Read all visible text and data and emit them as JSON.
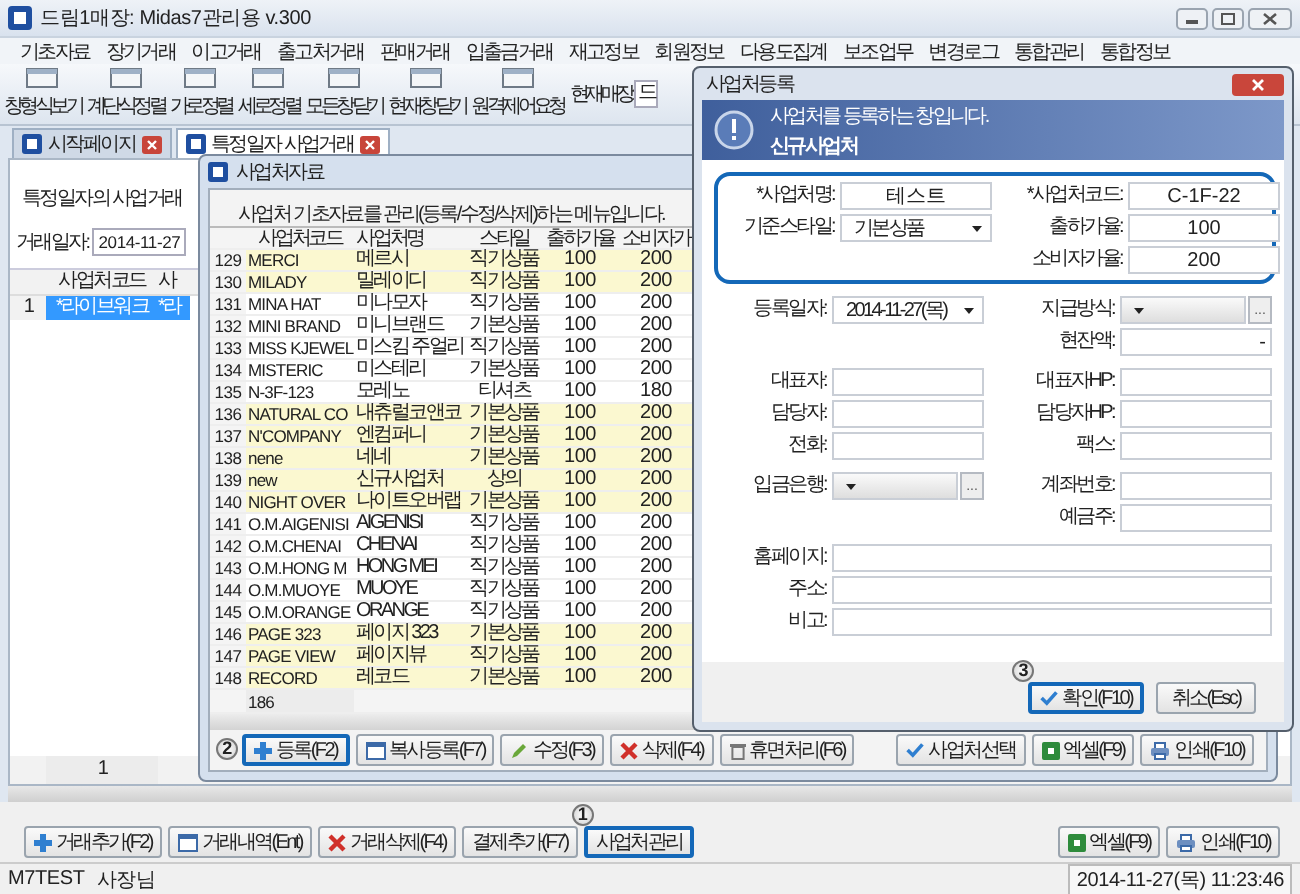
{
  "window": {
    "title": "드림1매장: Midas7관리용 v.300"
  },
  "menu": [
    "기초자료",
    "장기거래",
    "이고거래",
    "출고처거래",
    "판매거래",
    "입출금거래",
    "재고정보",
    "회원정보",
    "다용도집계",
    "보조업무",
    "변경로그",
    "통합관리",
    "통합정보"
  ],
  "toolbar": {
    "buttons": [
      "창형식보기",
      "계단식정렬",
      "가로정렬",
      "세로정렬",
      "모든창닫기",
      "현재창닫기",
      "원격제어요청"
    ],
    "store_label": "현재매장:",
    "store_value": "드"
  },
  "tabs": [
    {
      "label": "시작페이지",
      "selected": false
    },
    {
      "label": "특정일자 사업거래",
      "selected": true
    }
  ],
  "page": {
    "description": "특정일자의 사업거래",
    "date_label": "거래일자:",
    "date_value": "2014-11-27",
    "grid": {
      "columns": [
        "사업처코드",
        "사"
      ],
      "rows": [
        {
          "number": "1",
          "cells": [
            "*라이브워크",
            "*라"
          ],
          "selected": true
        }
      ],
      "footer": "1"
    }
  },
  "bottom_buttons": [
    {
      "label": "거래추가(F2)",
      "highlighted": false
    },
    {
      "label": "거래내역(Ent)",
      "highlighted": false
    },
    {
      "label": "거래삭제(F4)",
      "highlighted": false
    },
    {
      "label": "결제추가(F7)",
      "highlighted": false
    },
    {
      "label": "사업처관리",
      "highlighted": true,
      "callout": "1"
    }
  ],
  "bottom_right_buttons": [
    "엑셀(F9)",
    "인쇄(F10)"
  ],
  "status_bar": {
    "user": "M7TEST",
    "role": "사장님",
    "datetime": "2014-11-27(목) 11:23:46"
  },
  "child_window": {
    "title": "사업처자료",
    "description": "사업처 기초자료를 관리(등록/수정/삭제)하는 메뉴입니다.",
    "table": {
      "columns": [
        "사업처코드",
        "사업처명",
        "스타일",
        "출하가율",
        "소비자가"
      ],
      "rows": [
        {
          "number": "129",
          "cells": [
            "MERCI",
            "메르시",
            "직기상품",
            "100",
            "200"
          ],
          "highlighted": true
        },
        {
          "number": "130",
          "cells": [
            "MILADY",
            "밀레이디",
            "직기상품",
            "100",
            "200"
          ],
          "highlighted": true
        },
        {
          "number": "131",
          "cells": [
            "MINA HAT",
            "미나모자",
            "직기상품",
            "100",
            "200"
          ],
          "highlighted": false
        },
        {
          "number": "132",
          "cells": [
            "MINI BRAND",
            "미니브랜드",
            "기본상품",
            "100",
            "200"
          ],
          "highlighted": false
        },
        {
          "number": "133",
          "cells": [
            "MISS KJEWEL",
            "미스킴 주얼리",
            "직기상품",
            "100",
            "200"
          ],
          "highlighted": false
        },
        {
          "number": "134",
          "cells": [
            "MISTERIC",
            "미스테리",
            "기본상품",
            "100",
            "200"
          ],
          "highlighted": false
        },
        {
          "number": "135",
          "cells": [
            "N-3F-123",
            "모레노",
            "티셔츠",
            "100",
            "180"
          ],
          "highlighted": false
        },
        {
          "number": "136",
          "cells": [
            "NATURAL CO",
            "내츄럴코앤코",
            "기본상품",
            "100",
            "200"
          ],
          "highlighted": true
        },
        {
          "number": "137",
          "cells": [
            "N'COMPANY",
            "엔컴퍼니",
            "기본상품",
            "100",
            "200"
          ],
          "highlighted": true
        },
        {
          "number": "138",
          "cells": [
            "nene",
            "네네",
            "기본상품",
            "100",
            "200"
          ],
          "highlighted": true
        },
        {
          "number": "139",
          "cells": [
            "new",
            "신규사업처",
            "상의",
            "100",
            "200"
          ],
          "highlighted": true
        },
        {
          "number": "140",
          "cells": [
            "NIGHT OVER",
            "나이트오버랩",
            "기본상품",
            "100",
            "200"
          ],
          "highlighted": true
        },
        {
          "number": "141",
          "cells": [
            "O.M.AIGENISI",
            "AIGENISI",
            "직기상품",
            "100",
            "200"
          ],
          "highlighted": false
        },
        {
          "number": "142",
          "cells": [
            "O.M.CHENAI",
            "CHENAI",
            "직기상품",
            "100",
            "200"
          ],
          "highlighted": false
        },
        {
          "number": "143",
          "cells": [
            "O.M.HONG M",
            "HONG MEI",
            "직기상품",
            "100",
            "200"
          ],
          "highlighted": false
        },
        {
          "number": "144",
          "cells": [
            "O.M.MUOYE",
            "MUOYE",
            "직기상품",
            "100",
            "200"
          ],
          "highlighted": false
        },
        {
          "number": "145",
          "cells": [
            "O.M.ORANGE",
            "ORANGE",
            "직기상품",
            "100",
            "200"
          ],
          "highlighted": false
        },
        {
          "number": "146",
          "cells": [
            "PAGE 323",
            "페이지 323",
            "기본상품",
            "100",
            "200"
          ],
          "highlighted": true
        },
        {
          "number": "147",
          "cells": [
            "PAGE VIEW",
            "페이지뷰",
            "직기상품",
            "100",
            "200"
          ],
          "highlighted": true
        },
        {
          "number": "148",
          "cells": [
            "RECORD",
            "레코드",
            "기본상품",
            "100",
            "200"
          ],
          "highlighted": true
        }
      ],
      "footer": "186"
    },
    "buttons": [
      {
        "label": "등록(F2)",
        "highlighted": true,
        "callout": "2"
      },
      {
        "label": "복사등록(F7)",
        "highlighted": false
      },
      {
        "label": "수정(F3)",
        "highlighted": false
      },
      {
        "label": "삭제(F4)",
        "highlighted": false
      },
      {
        "label": "휴면처리(F6)",
        "highlighted": false
      }
    ],
    "right_buttons": [
      "사업처선택",
      "엑셀(F9)",
      "인쇄(F10)"
    ]
  },
  "dialog": {
    "title": "사업처등록",
    "banner_text": "사업처를 등록하는 창입니다.",
    "banner_title": "신규사업처",
    "sections": [
      {
        "highlighted": true,
        "rows": [
          {
            "left": {
              "label": "*사업처명:",
              "kind": "text",
              "value": "테스트"
            },
            "right": {
              "label": "*사업처코드:",
              "kind": "text",
              "value": "C-1F-22"
            }
          },
          {
            "left": {
              "label": "기준스타일:",
              "kind": "select",
              "value": "기본상품"
            },
            "right": {
              "label": "출하가율:",
              "kind": "text",
              "value": "100"
            }
          },
          {
            "right": {
              "label": "소비자가율:",
              "kind": "text",
              "value": "200"
            }
          }
        ]
      },
      {
        "highlighted": false,
        "rows": [
          {
            "left": {
              "label": "등록일자:",
              "kind": "select",
              "value": "2014-11-27(목)"
            },
            "right": {
              "label": "지급방식:",
              "kind": "select_more",
              "more": "..."
            }
          },
          {
            "right": {
              "label": "현잔액:",
              "kind": "amount",
              "value": "-"
            }
          }
        ]
      },
      {
        "highlighted": false,
        "rows": [
          {
            "left": {
              "label": "대표자:",
              "kind": "text"
            },
            "right": {
              "label": "대표자HP:",
              "kind": "text"
            }
          },
          {
            "left": {
              "label": "담당자:",
              "kind": "text"
            },
            "right": {
              "label": "담당자HP:",
              "kind": "text"
            }
          },
          {
            "left": {
              "label": "전화:",
              "kind": "text"
            },
            "right": {
              "label": "팩스:",
              "kind": "text"
            }
          }
        ]
      },
      {
        "highlighted": false,
        "rows": [
          {
            "left": {
              "label": "입금은행:",
              "kind": "select_more",
              "more": "..."
            },
            "right": {
              "label": "계좌번호:",
              "kind": "text"
            }
          },
          {
            "right": {
              "label": "예금주:",
              "kind": "text"
            }
          }
        ]
      },
      {
        "highlighted": false,
        "rows": [
          {
            "wide": {
              "label": "홈페이지:",
              "kind": "text"
            }
          },
          {
            "wide": {
              "label": "주소:",
              "kind": "text"
            }
          },
          {
            "wide": {
              "label": "비고:",
              "kind": "text"
            }
          }
        ]
      }
    ],
    "buttons": [
      {
        "label": "확인(F10)",
        "highlighted": true,
        "callout": "3"
      },
      {
        "label": "취소(Esc)",
        "highlighted": false
      }
    ]
  }
}
